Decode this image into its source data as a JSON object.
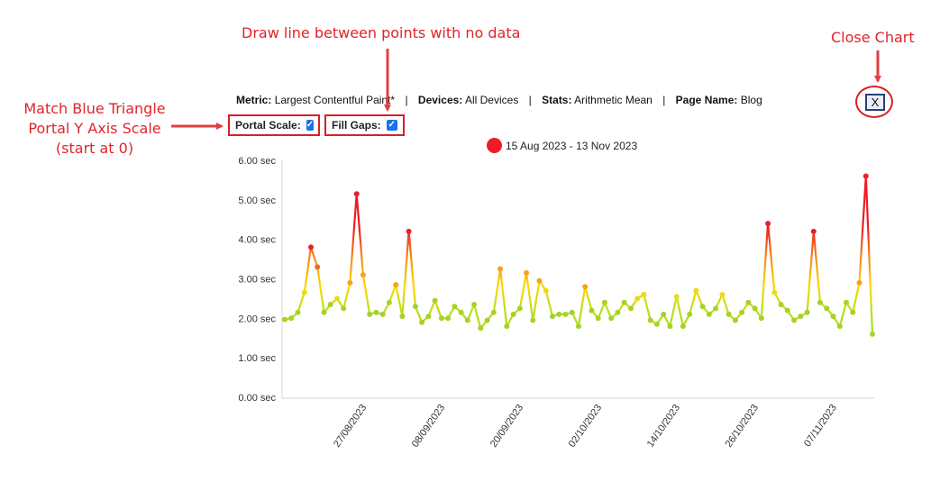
{
  "annotations": {
    "portal_scale": "Match Blue Triangle Portal Y Axis Scale (start at 0)",
    "fill_gaps": "Draw line between points with no data",
    "close_chart": "Close Chart"
  },
  "meta": {
    "metric_label": "Metric:",
    "metric_value": "Largest Contentful Paint*",
    "devices_label": "Devices:",
    "devices_value": "All Devices",
    "stats_label": "Stats:",
    "stats_value": "Arithmetic Mean",
    "page_label": "Page Name:",
    "page_value": "Blog",
    "separator": "|"
  },
  "options": {
    "portal_scale_label": "Portal Scale:",
    "portal_scale_checked": true,
    "fill_gaps_label": "Fill Gaps:",
    "fill_gaps_checked": true
  },
  "close_button_label": "X",
  "colors": {
    "low": "#9acd32",
    "mid": "#ffd700",
    "high": "#ee1c25",
    "legend": "#ee1c25"
  },
  "chart_data": {
    "type": "line",
    "series": [
      {
        "name": "15 Aug 2023 - 13 Nov 2023",
        "start": "15/08/2023",
        "step_days": 1,
        "values": [
          1.97,
          2.0,
          2.15,
          2.65,
          3.8,
          3.3,
          2.15,
          2.35,
          2.5,
          2.25,
          2.9,
          5.15,
          3.1,
          2.1,
          2.15,
          2.1,
          2.4,
          2.85,
          2.05,
          4.2,
          2.3,
          1.9,
          2.05,
          2.45,
          2.0,
          2.0,
          2.3,
          2.15,
          1.95,
          2.35,
          1.75,
          1.95,
          2.15,
          3.25,
          1.8,
          2.1,
          2.25,
          3.15,
          1.95,
          2.95,
          2.7,
          2.05,
          2.1,
          2.1,
          2.15,
          1.8,
          2.8,
          2.2,
          2.0,
          2.4,
          2.0,
          2.15,
          2.4,
          2.25,
          2.5,
          2.6,
          1.95,
          1.85,
          2.1,
          1.8,
          2.55,
          1.8,
          2.1,
          2.7,
          2.3,
          2.1,
          2.25,
          2.6,
          2.1,
          1.95,
          2.15,
          2.4,
          2.25,
          2.0,
          4.4,
          2.65,
          2.35,
          2.2,
          1.95,
          2.05,
          2.15,
          4.2,
          2.4,
          2.25,
          2.05,
          1.8,
          2.4,
          2.15,
          2.9,
          5.6,
          1.6
        ]
      }
    ],
    "y_ticks": [
      "0.00 sec",
      "1.00 sec",
      "2.00 sec",
      "3.00 sec",
      "4.00 sec",
      "5.00 sec",
      "6.00 sec"
    ],
    "x_ticks": [
      "27/08/2023",
      "08/09/2023",
      "20/09/2023",
      "02/10/2023",
      "14/10/2023",
      "26/10/2023",
      "07/11/2023"
    ],
    "ylim": [
      0,
      6
    ],
    "grid": false,
    "legend_position": "top"
  }
}
